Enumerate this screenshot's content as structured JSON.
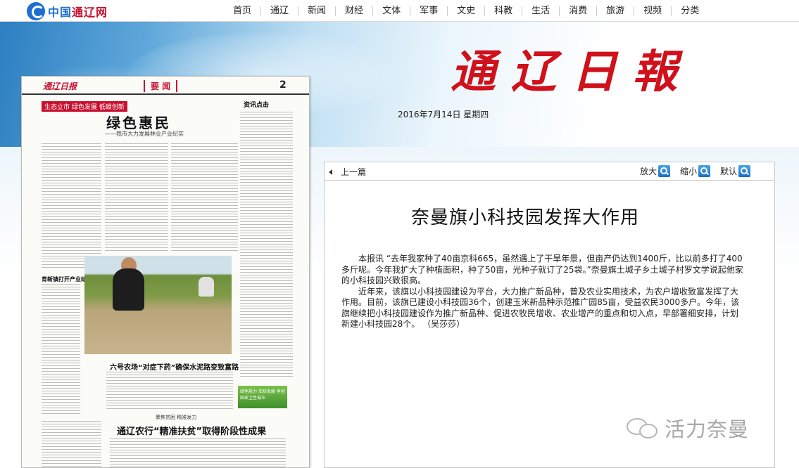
{
  "site": {
    "logo_prefix": "中国",
    "logo_name": "通辽网"
  },
  "nav": [
    "首页",
    "通辽",
    "新闻",
    "财经",
    "文体",
    "军事",
    "文史",
    "科教",
    "生活",
    "消费",
    "旅游",
    "视频",
    "分类"
  ],
  "banner": {
    "masthead": "通辽日報",
    "date": "2016年7月14日  星期四"
  },
  "paper": {
    "logo": "通辽日报",
    "section": "要 闻",
    "page_number": "2",
    "tag": "生态立市  绿色发展  低碳创新",
    "headline": "绿色惠民",
    "subheadline": "——我市大力发展林业产业纪实",
    "sidebar_head": "资讯点击",
    "left_note": "育新镇打开产业结构调整新局面",
    "headline2": "六号农场“对症下药”确保水泥路变致富路",
    "kicker3": "聚焦贫困  精准发力",
    "headline3": "通辽农行“精准扶贫”取得阶段性成果",
    "ad_text": "绿色能力 加快发展 争创国家卫生城市"
  },
  "viewer": {
    "prev_label": "上一篇",
    "zoom_in": "放大",
    "zoom_out": "缩小",
    "zoom_default": "默认",
    "title": "奈曼旗小科技园发挥大作用",
    "paragraphs": [
      "本报讯  “去年我家种了40亩京科665，虽然遇上了干旱年景，但亩产仍达到1400斤，比以前多打了400多斤呢。今年我扩大了种植面积，种了50亩，光种子就订了25袋。”奈曼旗土城子乡土城子村罗文学说起他家的小科技园兴致很高。",
      "近年来，该旗以小科技园建设为平台，大力推广新品种，普及农业实用技术，为农户增收致富发挥了大作用。目前，该旗已建设小科技园36个，创建玉米新品种示范推广园85亩，受益农民3000多户。今年，该旗继续把小科技园建设作为推广新品种、促进农牧民增收、农业增产的重点和切入点，早部署细安排，计划新建小科技园28个。  （吴莎莎）"
    ]
  },
  "watermark": "活力奈曼",
  "colors": {
    "masthead_red": "#d0101b",
    "accent_blue": "#1e6fd0"
  }
}
